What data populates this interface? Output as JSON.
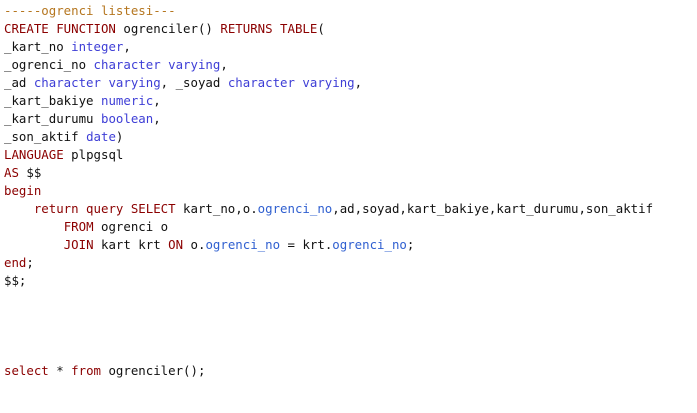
{
  "editor": {
    "lines": [
      [
        {
          "t": "-----ogrenci listesi---",
          "c": "comment"
        }
      ],
      [
        {
          "t": "CREATE FUNCTION",
          "c": "kw"
        },
        {
          "t": " ogrenciler",
          "c": "ident"
        },
        {
          "t": "() ",
          "c": "punct"
        },
        {
          "t": "RETURNS TABLE",
          "c": "kw"
        },
        {
          "t": "(",
          "c": "punct"
        }
      ],
      [
        {
          "t": "_kart_no ",
          "c": "ident"
        },
        {
          "t": "integer",
          "c": "type"
        },
        {
          "t": ",",
          "c": "punct"
        }
      ],
      [
        {
          "t": "_ogrenci_no ",
          "c": "ident"
        },
        {
          "t": "character varying",
          "c": "type"
        },
        {
          "t": ",",
          "c": "punct"
        }
      ],
      [
        {
          "t": "_ad ",
          "c": "ident"
        },
        {
          "t": "character varying",
          "c": "type"
        },
        {
          "t": ", _soyad ",
          "c": "ident"
        },
        {
          "t": "character varying",
          "c": "type"
        },
        {
          "t": ",",
          "c": "punct"
        }
      ],
      [
        {
          "t": "_kart_bakiye ",
          "c": "ident"
        },
        {
          "t": "numeric",
          "c": "type"
        },
        {
          "t": ",",
          "c": "punct"
        }
      ],
      [
        {
          "t": "_kart_durumu ",
          "c": "ident"
        },
        {
          "t": "boolean",
          "c": "type"
        },
        {
          "t": ",",
          "c": "punct"
        }
      ],
      [
        {
          "t": "_son_aktif ",
          "c": "ident"
        },
        {
          "t": "date",
          "c": "type"
        },
        {
          "t": ")",
          "c": "punct"
        }
      ],
      [
        {
          "t": "LANGUAGE",
          "c": "kw"
        },
        {
          "t": " plpgsql",
          "c": "ident"
        }
      ],
      [
        {
          "t": "AS",
          "c": "kw"
        },
        {
          "t": " $$",
          "c": "ident"
        }
      ],
      [
        {
          "t": "begin",
          "c": "kw"
        }
      ],
      [
        {
          "t": "    ",
          "c": "ident"
        },
        {
          "t": "return query SELECT",
          "c": "kw"
        },
        {
          "t": " kart_no,o.",
          "c": "ident"
        },
        {
          "t": "ogrenci_no",
          "c": "blue"
        },
        {
          "t": ",ad,soyad,kart_bakiye,kart_durumu,son_aktif",
          "c": "ident"
        }
      ],
      [
        {
          "t": "        ",
          "c": "ident"
        },
        {
          "t": "FROM",
          "c": "kw"
        },
        {
          "t": " ogrenci o",
          "c": "ident"
        }
      ],
      [
        {
          "t": "        ",
          "c": "ident"
        },
        {
          "t": "JOIN",
          "c": "kw"
        },
        {
          "t": " kart krt ",
          "c": "ident"
        },
        {
          "t": "ON",
          "c": "kw"
        },
        {
          "t": " o.",
          "c": "ident"
        },
        {
          "t": "ogrenci_no",
          "c": "blue"
        },
        {
          "t": " = krt.",
          "c": "ident"
        },
        {
          "t": "ogrenci_no",
          "c": "blue"
        },
        {
          "t": ";",
          "c": "punct"
        }
      ],
      [
        {
          "t": "end",
          "c": "kw"
        },
        {
          "t": ";",
          "c": "punct"
        }
      ],
      [
        {
          "t": "$$;",
          "c": "ident"
        }
      ],
      [],
      [],
      [],
      [],
      [
        {
          "t": "select",
          "c": "kw"
        },
        {
          "t": " * ",
          "c": "ident"
        },
        {
          "t": "from",
          "c": "kw"
        },
        {
          "t": " ogrenciler();",
          "c": "ident"
        }
      ]
    ]
  },
  "colors": {
    "comment": "#b5761f",
    "keyword": "#8b0000",
    "type": "#3e3ed6",
    "identifier": "#111111",
    "column_ref": "#2f5fd0",
    "background": "#ffffff"
  }
}
